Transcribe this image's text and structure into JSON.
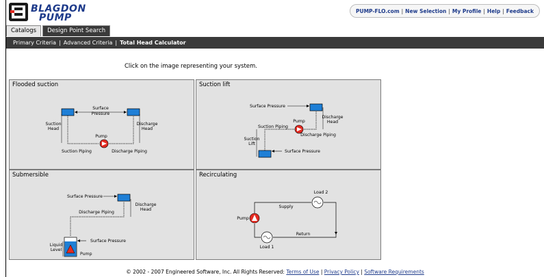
{
  "brand": {
    "line1": "BLAGDON",
    "line2": "PUMP"
  },
  "top_links": [
    "PUMP-FLO.com",
    "New Selection",
    "My Profile",
    "Help",
    "Feedback"
  ],
  "tabs": [
    {
      "label": "Catalogs"
    },
    {
      "label": "Design Point Search"
    }
  ],
  "subnav": [
    "Primary Criteria",
    "Advanced Criteria",
    "Total Head Calculator"
  ],
  "instruction": "Click on the image representing your system.",
  "panels": {
    "flooded": {
      "title": "Flooded suction",
      "labels": {
        "surface": "Surface",
        "pressure": "Pressure",
        "suction": "Suction",
        "head": "Head",
        "discharge": "Discharge",
        "head2": "Head",
        "pump": "Pump",
        "suction_piping": "Suction Piping",
        "discharge_piping": "Discharge Piping"
      }
    },
    "lift": {
      "title": "Suction lift",
      "labels": {
        "surface_pressure": "Surface Pressure",
        "discharge": "Discharge",
        "head": "Head",
        "pump": "Pump",
        "suction_piping": "Suction Piping",
        "discharge_piping": "Discharge Piping",
        "suction": "Suction",
        "lift": "Lift",
        "surface_pressure2": "Surface Pressure"
      }
    },
    "submersible": {
      "title": "Submersible",
      "labels": {
        "surface_pressure": "Surface Pressure",
        "discharge": "Discharge",
        "head": "Head",
        "discharge_piping": "Discharge Piping",
        "surface_pressure2": "Surface Pressure",
        "liquid": "Liquid",
        "level": "Level",
        "pump": "Pump"
      }
    },
    "recirc": {
      "title": "Recirculating",
      "labels": {
        "load2": "Load 2",
        "supply": "Supply",
        "pump": "Pump",
        "return": "Return",
        "load1": "Load 1"
      }
    }
  },
  "footer": {
    "copyright": "© 2002 - 2007 Engineered Software, Inc. All Rights Reserved:",
    "links": [
      "Terms of Use",
      "Privacy Policy",
      "Software Requirements"
    ]
  },
  "colors": {
    "brand_blue": "#1d3a8a",
    "tank_blue": "#1e7fd6",
    "pump_red": "#e32b22",
    "nav_dark": "#3a3a3a",
    "panel_gray": "#e2e2e2"
  }
}
